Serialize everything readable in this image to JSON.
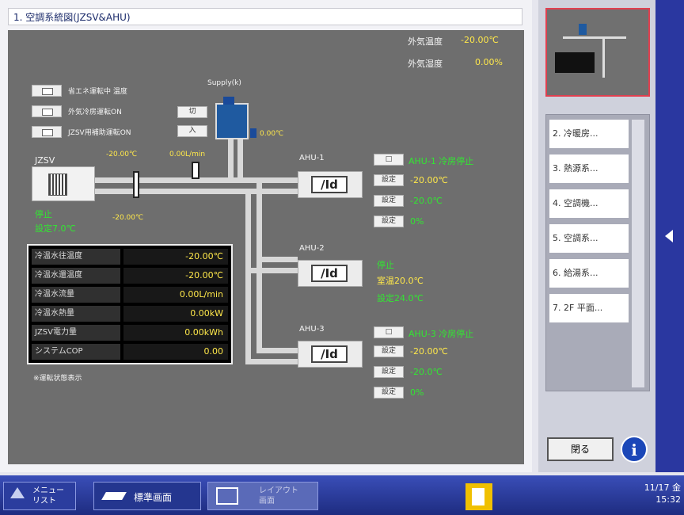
{
  "window": {
    "title": "1. 空調系統図(JZSV&AHU)"
  },
  "outdoor": {
    "temp_label": "外気温度",
    "temp_value": "-20.00℃",
    "humid_label": "外気湿度",
    "humid_value": "0.00%"
  },
  "controls": [
    {
      "label": "省エネ運転中 温度"
    },
    {
      "label": "外気冷房運転ON"
    },
    {
      "label": "JZSV用補助運転ON"
    }
  ],
  "small_buttons": [
    "切",
    "入"
  ],
  "supply": {
    "label": "Supply(k)",
    "temp": "0.00℃"
  },
  "jzsv": {
    "label": "JZSV",
    "status": "停止",
    "setpoint": "設定7.0℃"
  },
  "pipe_readings": {
    "t1": "-20.00℃",
    "t2": "0.00L/min",
    "t3": "-20.00℃"
  },
  "ahus": [
    {
      "name": "AHU-1",
      "status_line": "AHU-1 冷房停止",
      "lines": [
        "-20.00℃",
        "-20.0℃",
        "0%"
      ],
      "badges": [
        "□",
        "設定",
        "設定",
        "設定"
      ]
    },
    {
      "name": "AHU-2",
      "status_line": "停止",
      "lines": [
        "室温20.0℃",
        "設定24.0℃"
      ],
      "badges": []
    },
    {
      "name": "AHU-3",
      "status_line": "AHU-3 冷房停止",
      "lines": [
        "-20.00℃",
        "-20.0℃",
        "0%"
      ],
      "badges": [
        "□",
        "設定",
        "設定",
        "設定"
      ]
    }
  ],
  "unit_symbol": "/Id",
  "table": [
    {
      "label": "冷温水往温度",
      "value": "-20.00℃"
    },
    {
      "label": "冷温水還温度",
      "value": "-20.00℃"
    },
    {
      "label": "冷温水流量",
      "value": "0.00L/min"
    },
    {
      "label": "冷温水熱量",
      "value": "0.00kW"
    },
    {
      "label": "JZSV電力量",
      "value": "0.00kWh"
    },
    {
      "label": "システムCOP",
      "value": "0.00"
    }
  ],
  "note": "※運転状態表示",
  "side_list": [
    {
      "label": "2. 冷暖房..."
    },
    {
      "label": "3. 熱源系..."
    },
    {
      "label": "4. 空調機..."
    },
    {
      "label": "5. 空調系..."
    },
    {
      "label": "6. 給湯系..."
    },
    {
      "label": "7. 2F 平面..."
    }
  ],
  "close_label": "閉る",
  "taskbar": {
    "menu_label": "メニュー リスト",
    "main_label": "標準画面",
    "sub_label": "レイアウト 画面",
    "clock_date": "11/17 金",
    "clock_time": "15:32"
  },
  "colors": {
    "accent": "#2a37a0",
    "value_yellow": "#ffe84a",
    "status_green": "#32e632"
  }
}
